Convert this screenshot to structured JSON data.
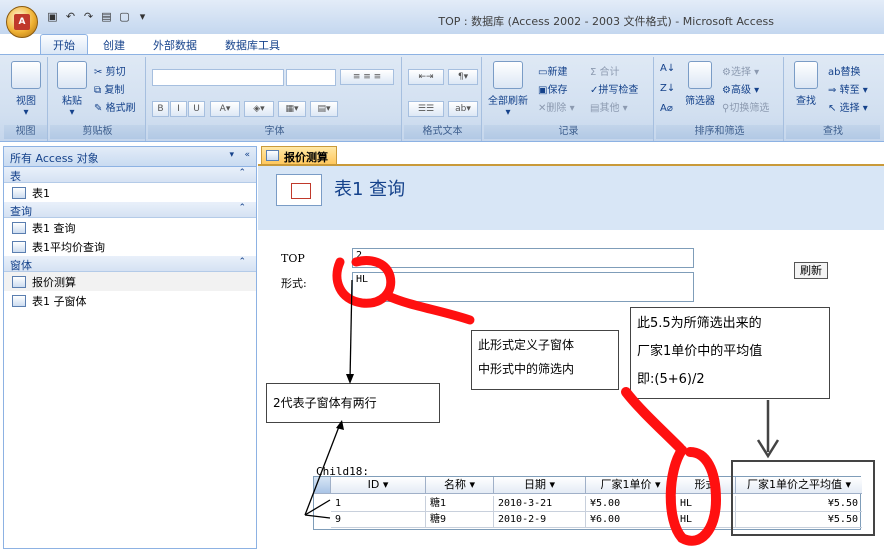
{
  "window": {
    "title": "TOP : 数据库 (Access 2002 - 2003 文件格式) - Microsoft Access"
  },
  "ribbon": {
    "tabs": [
      "开始",
      "创建",
      "外部数据",
      "数据库工具"
    ],
    "active_tab": "开始",
    "groups": {
      "view": {
        "label": "视图",
        "button": "视图"
      },
      "clipboard": {
        "label": "剪贴板",
        "paste": "粘贴",
        "cut": "剪切",
        "copy": "复制",
        "format_painter": "格式刷"
      },
      "font": {
        "label": "字体"
      },
      "rich_text": {
        "label": "格式文本"
      },
      "records": {
        "label": "记录",
        "refresh_all": "全部刷新",
        "new": "新建",
        "save": "保存",
        "delete": "删除",
        "totals": "合计",
        "spelling": "拼写检查",
        "more": "其他"
      },
      "sort_filter": {
        "label": "排序和筛选",
        "filter": "筛选器",
        "selection": "选择",
        "advanced": "高级",
        "toggle_filter": "切换筛选"
      },
      "find": {
        "label": "查找",
        "find": "查找",
        "replace": "替换",
        "goto": "转至",
        "select": "选择"
      }
    }
  },
  "nav_pane": {
    "header": "所有 Access 对象",
    "sections": [
      {
        "title": "表",
        "items": [
          "表1"
        ]
      },
      {
        "title": "查询",
        "items": [
          "表1 查询",
          "表1平均价查询"
        ]
      },
      {
        "title": "窗体",
        "items": [
          "报价测算",
          "表1 子窗体"
        ]
      }
    ],
    "selected_item": "报价测算"
  },
  "document": {
    "tab": "报价测算",
    "form_title": "表1 查询",
    "fields": {
      "top_label": "TOP",
      "top_value": "2",
      "form_label": "形式:",
      "form_value": "HL"
    },
    "refresh_button": "刷新",
    "subform_label": "Child18:",
    "subform": {
      "columns": [
        "ID",
        "名称",
        "日期",
        "厂家1单价",
        "形式",
        "厂家1单价之平均值"
      ],
      "rows": [
        [
          "1",
          "糖1",
          "2010-3-21",
          "¥5.00",
          "HL",
          "¥5.50"
        ],
        [
          "9",
          "糖9",
          "2010-2-9",
          "¥6.00",
          "HL",
          "¥5.50"
        ]
      ]
    }
  },
  "annotations": {
    "callout_filter_lines": [
      "此形式定义子窗体",
      "中形式中的筛选内"
    ],
    "callout_avg_lines": [
      "此5.5为所筛选出来的",
      "厂家1单价中的平均值",
      "即:(5+6)/2"
    ],
    "callout_rows": "2代表子窗体有两行",
    "highlight_color": "#ff1010"
  }
}
